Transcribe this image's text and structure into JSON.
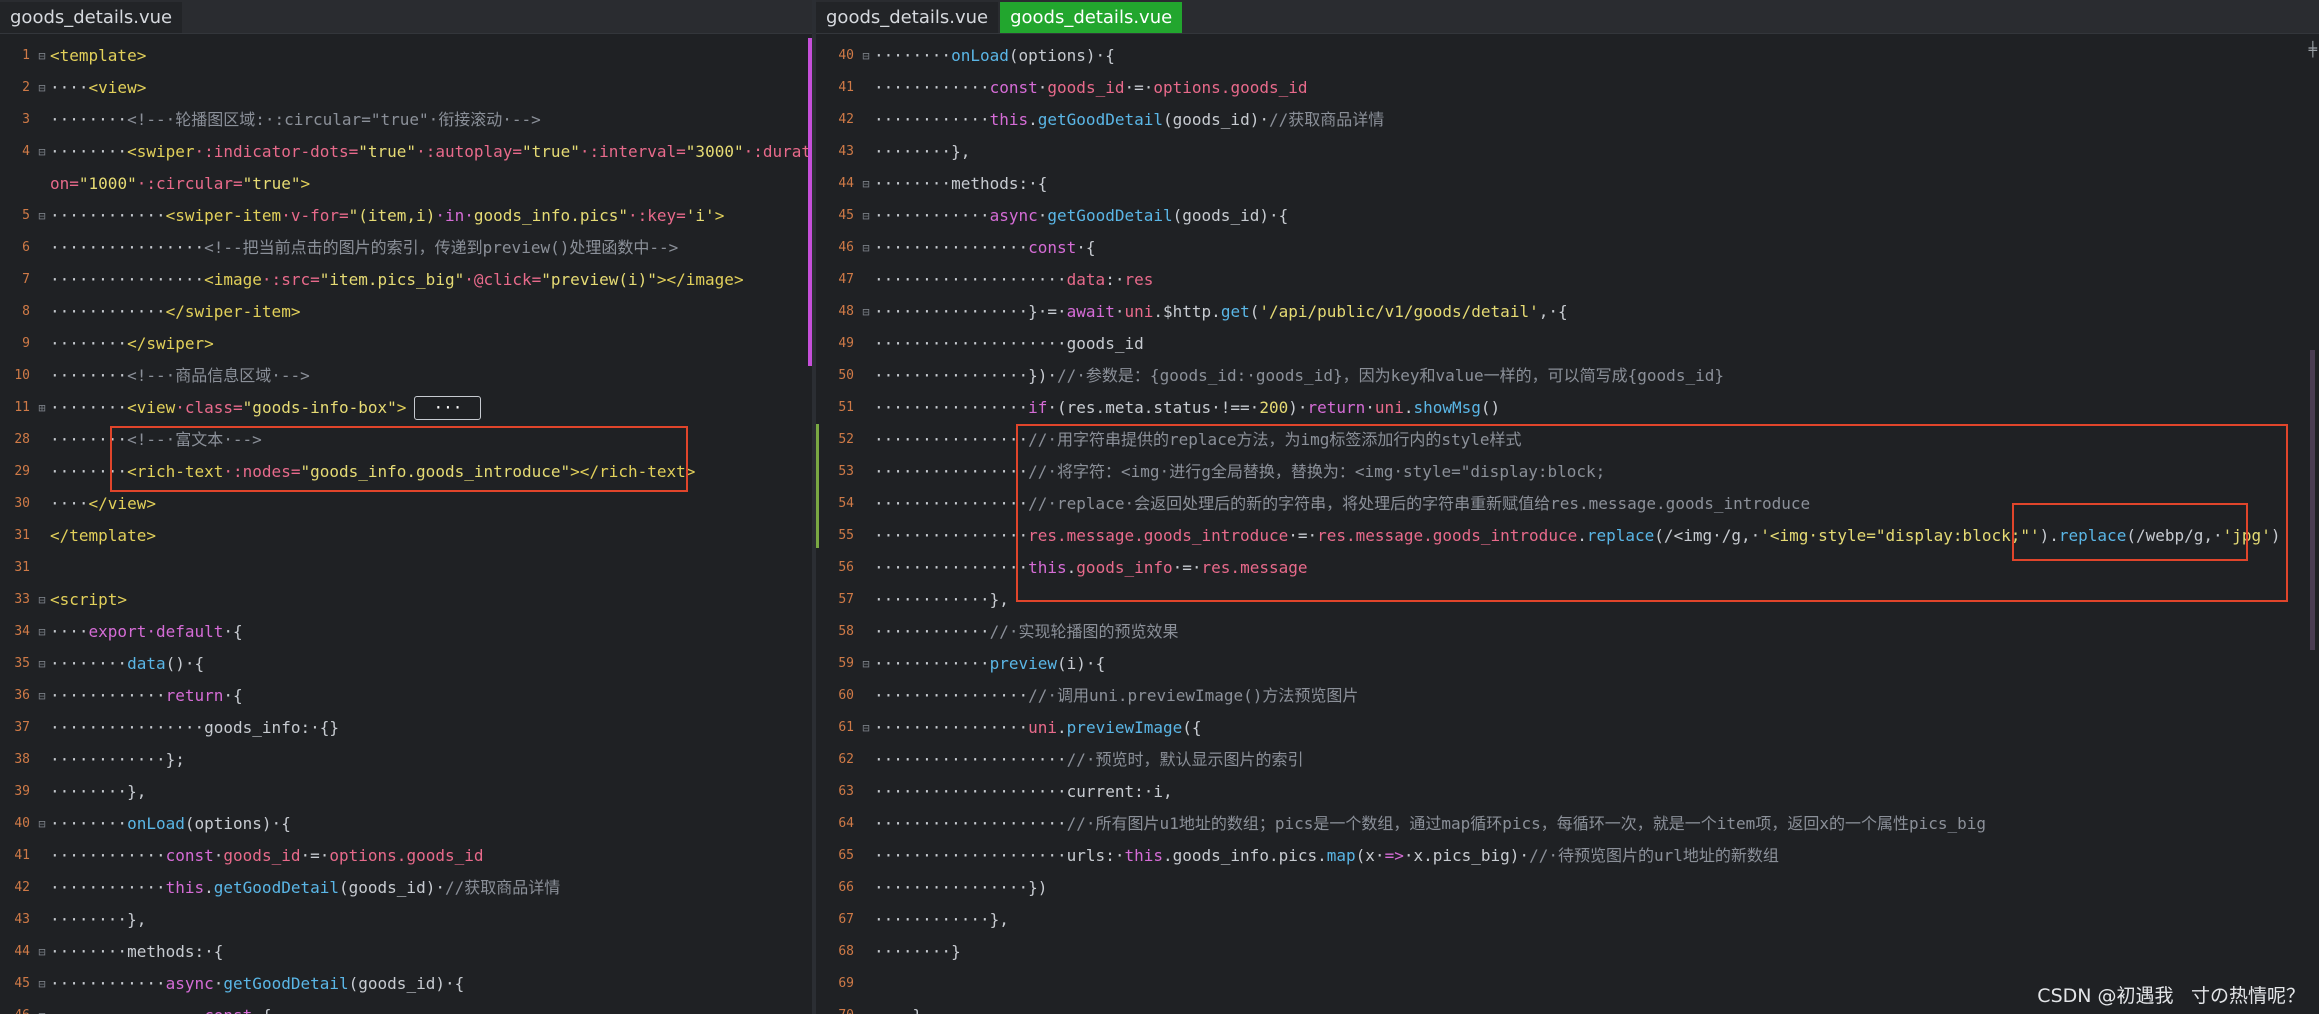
{
  "tabs": {
    "left": [
      "goods_details.vue"
    ],
    "right": [
      "goods_details.vue",
      "goods_details.vue"
    ]
  },
  "colors": {
    "tag": "#e2d05a",
    "attr": "#e86a8b",
    "string": "#e6db74",
    "comment": "#8b9099",
    "keyword": "#d56cd6",
    "func": "#5ab6e6",
    "plain": "#c7cbd1",
    "line_number": "#cf7a47",
    "active_tab": "#22a62e",
    "highlight_box": "#e0452b"
  },
  "left_lines": [
    {
      "n": "1",
      "fold": "⊟",
      "segs": [
        [
          "tag",
          "<template>"
        ]
      ]
    },
    {
      "n": "2",
      "fold": "⊟",
      "segs": [
        [
          "p",
          "····"
        ],
        [
          "tag",
          "<view>"
        ]
      ]
    },
    {
      "n": "3",
      "fold": "",
      "segs": [
        [
          "p",
          "········"
        ],
        [
          "c",
          "<!--·轮播图区域:·:circular=\"true\"·衔接滚动·-->"
        ]
      ]
    },
    {
      "n": "4",
      "fold": "⊟",
      "segs": [
        [
          "p",
          "········"
        ],
        [
          "tag",
          "<swiper"
        ],
        [
          "attr",
          "·:indicator-dots="
        ],
        [
          "s",
          "\"true\""
        ],
        [
          "attr",
          "·:autoplay="
        ],
        [
          "s",
          "\"true\""
        ],
        [
          "attr",
          "·:interval="
        ],
        [
          "s",
          "\"3000\""
        ],
        [
          "attr",
          "·:durati"
        ]
      ]
    },
    {
      "n": "",
      "fold": "",
      "segs": [
        [
          "attr",
          "on="
        ],
        [
          "s",
          "\"1000\""
        ],
        [
          "attr",
          "·:circular="
        ],
        [
          "s",
          "\"true\""
        ],
        [
          "tag",
          ">"
        ]
      ]
    },
    {
      "n": "5",
      "fold": "⊟",
      "segs": [
        [
          "p",
          "············"
        ],
        [
          "tag",
          "<swiper-item"
        ],
        [
          "attr",
          "·v-for="
        ],
        [
          "s",
          "\"(item,i)"
        ],
        [
          "k",
          "·in·"
        ],
        [
          "s",
          "goods_info.pics\""
        ],
        [
          "attr",
          "·:key="
        ],
        [
          "s",
          "'i'"
        ],
        [
          "tag",
          ">"
        ]
      ]
    },
    {
      "n": "6",
      "fold": "",
      "segs": [
        [
          "p",
          "················"
        ],
        [
          "c",
          "<!--把当前点击的图片的索引，传递到preview()处理函数中-->"
        ]
      ]
    },
    {
      "n": "7",
      "fold": "",
      "segs": [
        [
          "p",
          "················"
        ],
        [
          "tag",
          "<image"
        ],
        [
          "attr",
          "·:src="
        ],
        [
          "s",
          "\"item.pics_big\""
        ],
        [
          "attr",
          "·@click="
        ],
        [
          "s",
          "\"preview(i)\""
        ],
        [
          "tag",
          "></image>"
        ]
      ]
    },
    {
      "n": "8",
      "fold": "",
      "segs": [
        [
          "p",
          "············"
        ],
        [
          "tag",
          "</swiper-item>"
        ]
      ]
    },
    {
      "n": "9",
      "fold": "",
      "segs": [
        [
          "p",
          "········"
        ],
        [
          "tag",
          "</swiper>"
        ]
      ]
    },
    {
      "n": "10",
      "fold": "",
      "segs": [
        [
          "p",
          "········"
        ],
        [
          "c",
          "<!--·商品信息区域·-->"
        ]
      ]
    },
    {
      "n": "11",
      "fold": "⊞",
      "segs": [
        [
          "p",
          "········"
        ],
        [
          "tag",
          "<view"
        ],
        [
          "attr",
          "·class="
        ],
        [
          "s",
          "\"goods-info-box\""
        ],
        [
          "tag",
          ">"
        ]
      ],
      "ellipsis": "···"
    },
    {
      "n": "28",
      "fold": "",
      "segs": [
        [
          "p",
          "········"
        ],
        [
          "c",
          "<!--·富文本·-->"
        ]
      ]
    },
    {
      "n": "29",
      "fold": "",
      "segs": [
        [
          "p",
          "········"
        ],
        [
          "tag",
          "<rich-text"
        ],
        [
          "attr",
          "·:nodes="
        ],
        [
          "s",
          "\"goods_info.goods_introduce\""
        ],
        [
          "tag",
          "></rich-text>"
        ]
      ]
    },
    {
      "n": "30",
      "fold": "",
      "segs": [
        [
          "p",
          "····"
        ],
        [
          "tag",
          "</view>"
        ]
      ]
    },
    {
      "n": "31",
      "fold": "",
      "segs": [
        [
          "tag",
          "</template>"
        ]
      ]
    },
    {
      "n": "31",
      "fold": "",
      "segs": []
    },
    {
      "n": "33",
      "fold": "⊟",
      "segs": [
        [
          "tag",
          "<script>"
        ]
      ]
    },
    {
      "n": "34",
      "fold": "⊟",
      "segs": [
        [
          "p",
          "····"
        ],
        [
          "k",
          "export·default"
        ],
        [
          "p",
          "·{"
        ]
      ]
    },
    {
      "n": "35",
      "fold": "⊟",
      "segs": [
        [
          "p",
          "········"
        ],
        [
          "f",
          "data"
        ],
        [
          "p",
          "()·{"
        ]
      ]
    },
    {
      "n": "36",
      "fold": "⊟",
      "segs": [
        [
          "p",
          "············"
        ],
        [
          "k",
          "return"
        ],
        [
          "p",
          "·{"
        ]
      ]
    },
    {
      "n": "37",
      "fold": "",
      "segs": [
        [
          "p",
          "················goods_info:·{}"
        ]
      ]
    },
    {
      "n": "38",
      "fold": "",
      "segs": [
        [
          "p",
          "············};"
        ]
      ]
    },
    {
      "n": "39",
      "fold": "",
      "segs": [
        [
          "p",
          "········},"
        ]
      ]
    },
    {
      "n": "40",
      "fold": "⊟",
      "segs": [
        [
          "p",
          "········"
        ],
        [
          "f",
          "onLoad"
        ],
        [
          "p",
          "(options)·{"
        ]
      ]
    },
    {
      "n": "41",
      "fold": "",
      "segs": [
        [
          "p",
          "············"
        ],
        [
          "k",
          "const"
        ],
        [
          "p",
          "·"
        ],
        [
          "attr",
          "goods_id"
        ],
        [
          "p",
          "·=·"
        ],
        [
          "attr",
          "options.goods_id"
        ]
      ]
    },
    {
      "n": "42",
      "fold": "",
      "segs": [
        [
          "p",
          "············"
        ],
        [
          "k",
          "this"
        ],
        [
          "p",
          "."
        ],
        [
          "f",
          "getGoodDetail"
        ],
        [
          "p",
          "(goods_id)·"
        ],
        [
          "c",
          "//获取商品详情"
        ]
      ]
    },
    {
      "n": "43",
      "fold": "",
      "segs": [
        [
          "p",
          "········},"
        ]
      ]
    },
    {
      "n": "44",
      "fold": "⊟",
      "segs": [
        [
          "p",
          "········methods:·{"
        ]
      ]
    },
    {
      "n": "45",
      "fold": "⊟",
      "segs": [
        [
          "p",
          "············"
        ],
        [
          "k",
          "async"
        ],
        [
          "p",
          "·"
        ],
        [
          "f",
          "getGoodDetail"
        ],
        [
          "p",
          "(goods_id)·{"
        ]
      ]
    },
    {
      "n": "46",
      "fold": "⊟",
      "segs": [
        [
          "p",
          "················"
        ],
        [
          "k",
          "const"
        ],
        [
          "p",
          "·{"
        ]
      ]
    }
  ],
  "right_lines": [
    {
      "n": "40",
      "fold": "⊟",
      "segs": [
        [
          "p",
          "········"
        ],
        [
          "f",
          "onLoad"
        ],
        [
          "p",
          "(options)·{"
        ]
      ]
    },
    {
      "n": "41",
      "fold": "",
      "segs": [
        [
          "p",
          "············"
        ],
        [
          "k",
          "const"
        ],
        [
          "p",
          "·"
        ],
        [
          "attr",
          "goods_id"
        ],
        [
          "p",
          "·=·"
        ],
        [
          "attr",
          "options.goods_id"
        ]
      ]
    },
    {
      "n": "42",
      "fold": "",
      "segs": [
        [
          "p",
          "············"
        ],
        [
          "k",
          "this"
        ],
        [
          "p",
          "."
        ],
        [
          "f",
          "getGoodDetail"
        ],
        [
          "p",
          "(goods_id)·"
        ],
        [
          "c",
          "//获取商品详情"
        ]
      ]
    },
    {
      "n": "43",
      "fold": "",
      "segs": [
        [
          "p",
          "········},"
        ]
      ]
    },
    {
      "n": "44",
      "fold": "⊟",
      "segs": [
        [
          "p",
          "········methods:·{"
        ]
      ]
    },
    {
      "n": "45",
      "fold": "⊟",
      "segs": [
        [
          "p",
          "············"
        ],
        [
          "k",
          "async"
        ],
        [
          "p",
          "·"
        ],
        [
          "f",
          "getGoodDetail"
        ],
        [
          "p",
          "(goods_id)·{"
        ]
      ]
    },
    {
      "n": "46",
      "fold": "⊟",
      "segs": [
        [
          "p",
          "················"
        ],
        [
          "k",
          "const"
        ],
        [
          "p",
          "·{"
        ]
      ]
    },
    {
      "n": "47",
      "fold": "",
      "segs": [
        [
          "p",
          "····················"
        ],
        [
          "attr",
          "data"
        ],
        [
          "p",
          ":·"
        ],
        [
          "attr",
          "res"
        ]
      ]
    },
    {
      "n": "48",
      "fold": "⊟",
      "segs": [
        [
          "p",
          "················}·=·"
        ],
        [
          "k",
          "await"
        ],
        [
          "p",
          "·"
        ],
        [
          "attr",
          "uni"
        ],
        [
          "p",
          ".$http."
        ],
        [
          "f",
          "get"
        ],
        [
          "p",
          "("
        ],
        [
          "s",
          "'/api/public/v1/goods/detail'"
        ],
        [
          "p",
          ",·{"
        ]
      ]
    },
    {
      "n": "49",
      "fold": "",
      "segs": [
        [
          "p",
          "····················goods_id"
        ]
      ]
    },
    {
      "n": "50",
      "fold": "",
      "segs": [
        [
          "p",
          "················})·"
        ],
        [
          "c",
          "//·参数是：{goods_id:·goods_id}，因为key和value一样的，可以简写成{goods_id}"
        ]
      ]
    },
    {
      "n": "51",
      "fold": "",
      "segs": [
        [
          "p",
          "················"
        ],
        [
          "k",
          "if"
        ],
        [
          "p",
          "·(res.meta.status·!==·"
        ],
        [
          "s",
          "200"
        ],
        [
          "p",
          ")·"
        ],
        [
          "k",
          "return"
        ],
        [
          "p",
          "·"
        ],
        [
          "attr",
          "uni"
        ],
        [
          "p",
          "."
        ],
        [
          "f",
          "showMsg"
        ],
        [
          "p",
          "()"
        ]
      ]
    },
    {
      "n": "52",
      "fold": "",
      "segs": [
        [
          "p",
          "················"
        ],
        [
          "c",
          "//·用字符串提供的replace方法，为img标签添加行内的style样式"
        ]
      ]
    },
    {
      "n": "53",
      "fold": "",
      "segs": [
        [
          "p",
          "················"
        ],
        [
          "c",
          "//·将字符：<img·进行g全局替换，替换为：<img·style=\"display:block;"
        ]
      ]
    },
    {
      "n": "54",
      "fold": "",
      "segs": [
        [
          "p",
          "················"
        ],
        [
          "c",
          "//·replace·会返回处理后的新的字符串，将处理后的字符串重新赋值给res.message.goods_introduce"
        ]
      ]
    },
    {
      "n": "55",
      "fold": "",
      "segs": [
        [
          "p",
          "················"
        ],
        [
          "attr",
          "res.message.goods_introduce"
        ],
        [
          "p",
          "·=·"
        ],
        [
          "attr",
          "res.message.goods_introduce"
        ],
        [
          "p",
          "."
        ],
        [
          "f",
          "replace"
        ],
        [
          "p",
          "(/<img·/g,·"
        ],
        [
          "s",
          "'<img·style=\"display:block;\"'"
        ],
        [
          "p",
          ")."
        ],
        [
          "f",
          "replace"
        ],
        [
          "p",
          "(/webp/g,·"
        ],
        [
          "s",
          "'jpg'"
        ],
        [
          "p",
          ")"
        ]
      ]
    },
    {
      "n": "56",
      "fold": "",
      "segs": [
        [
          "p",
          "················"
        ],
        [
          "k",
          "this"
        ],
        [
          "p",
          "."
        ],
        [
          "attr",
          "goods_info"
        ],
        [
          "p",
          "·=·"
        ],
        [
          "attr",
          "res.message"
        ]
      ]
    },
    {
      "n": "57",
      "fold": "",
      "segs": [
        [
          "p",
          "············},"
        ]
      ]
    },
    {
      "n": "58",
      "fold": "",
      "segs": [
        [
          "p",
          "············"
        ],
        [
          "c",
          "//·实现轮播图的预览效果"
        ]
      ]
    },
    {
      "n": "59",
      "fold": "⊟",
      "segs": [
        [
          "p",
          "············"
        ],
        [
          "f",
          "preview"
        ],
        [
          "p",
          "(i)·{"
        ]
      ]
    },
    {
      "n": "60",
      "fold": "",
      "segs": [
        [
          "p",
          "················"
        ],
        [
          "c",
          "//·调用uni.previewImage()方法预览图片"
        ]
      ]
    },
    {
      "n": "61",
      "fold": "⊟",
      "segs": [
        [
          "p",
          "················"
        ],
        [
          "attr",
          "uni"
        ],
        [
          "p",
          "."
        ],
        [
          "f",
          "previewImage"
        ],
        [
          "p",
          "({"
        ]
      ]
    },
    {
      "n": "62",
      "fold": "",
      "segs": [
        [
          "p",
          "····················"
        ],
        [
          "c",
          "//·预览时，默认显示图片的索引"
        ]
      ]
    },
    {
      "n": "63",
      "fold": "",
      "segs": [
        [
          "p",
          "····················current:·i,"
        ]
      ]
    },
    {
      "n": "64",
      "fold": "",
      "segs": [
        [
          "p",
          "····················"
        ],
        [
          "c",
          "//·所有图片u1地址的数组；pics是一个数组，通过map循环pics，每循环一次，就是一个item项，返回x的一个属性pics_big"
        ]
      ]
    },
    {
      "n": "65",
      "fold": "",
      "segs": [
        [
          "p",
          "····················urls:·"
        ],
        [
          "k",
          "this"
        ],
        [
          "p",
          ".goods_info.pics."
        ],
        [
          "f",
          "map"
        ],
        [
          "p",
          "(x·"
        ],
        [
          "k",
          "=>"
        ],
        [
          "p",
          "·x.pics_big)·"
        ],
        [
          "c",
          "//·待预览图片的url地址的新数组"
        ]
      ]
    },
    {
      "n": "66",
      "fold": "",
      "segs": [
        [
          "p",
          "················})"
        ]
      ]
    },
    {
      "n": "67",
      "fold": "",
      "segs": [
        [
          "p",
          "············},"
        ]
      ]
    },
    {
      "n": "68",
      "fold": "",
      "segs": [
        [
          "p",
          "········}"
        ]
      ]
    },
    {
      "n": "69",
      "fold": "",
      "segs": []
    },
    {
      "n": "70",
      "fold": "",
      "segs": [
        [
          "p",
          "····}"
        ]
      ]
    }
  ],
  "watermark": "CSDN @初遇我ㅤ寸の热情呢？"
}
